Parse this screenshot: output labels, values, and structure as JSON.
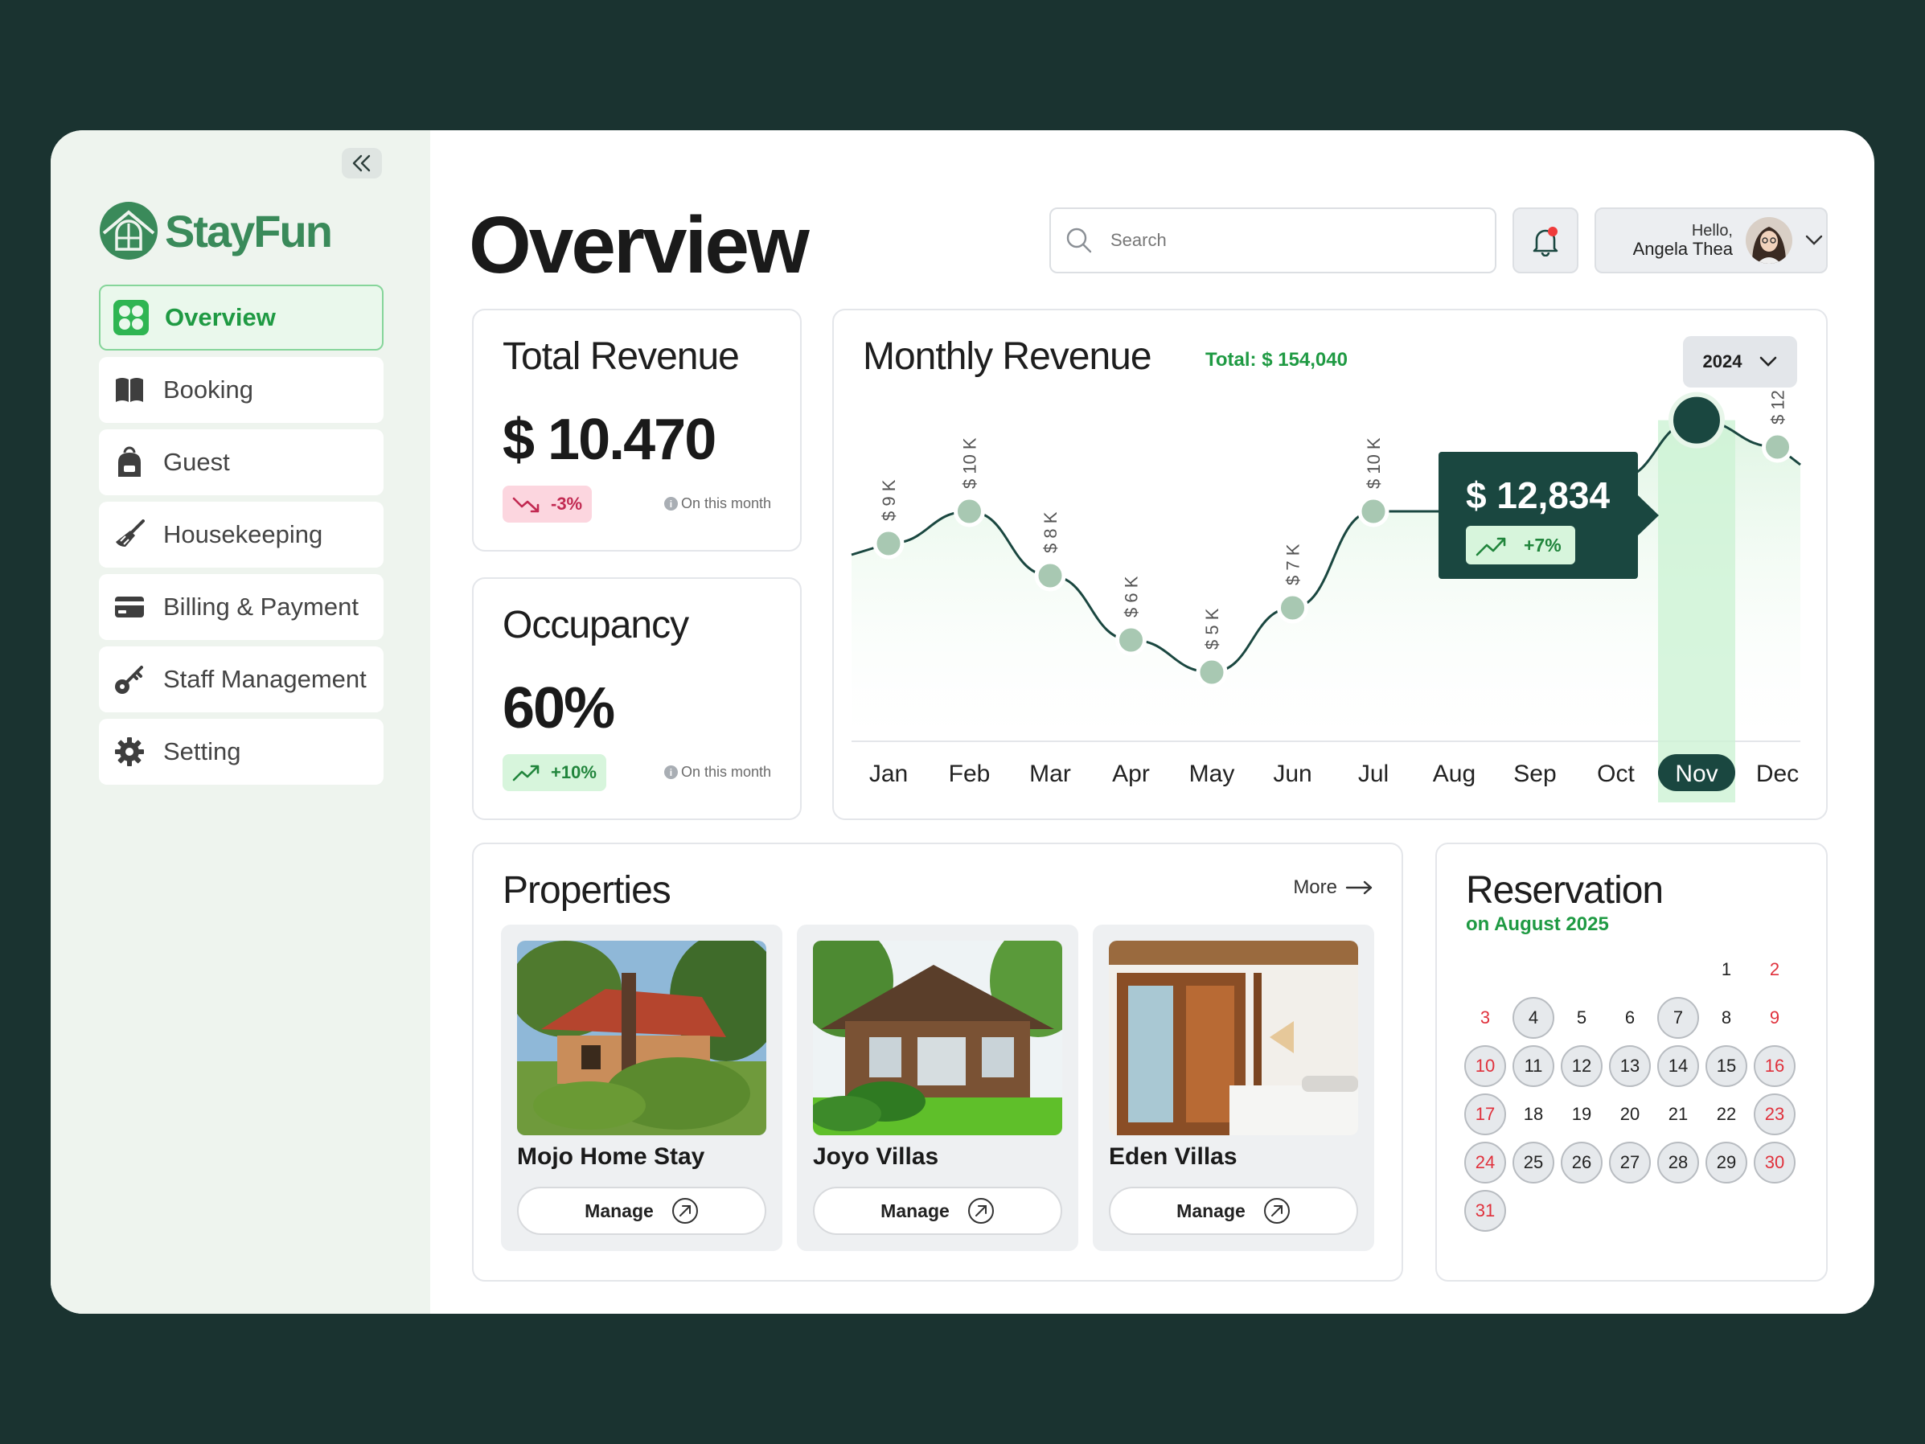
{
  "app": {
    "brand": "StayFun",
    "page_title": "Overview"
  },
  "sidebar": {
    "items": [
      {
        "label": "Overview",
        "icon": "grid-icon",
        "active": true
      },
      {
        "label": "Booking",
        "icon": "book-icon",
        "active": false
      },
      {
        "label": "Guest",
        "icon": "backpack-icon",
        "active": false
      },
      {
        "label": "Housekeeping",
        "icon": "broom-icon",
        "active": false
      },
      {
        "label": "Billing & Payment",
        "icon": "card-icon",
        "active": false
      },
      {
        "label": "Staff Management",
        "icon": "key-icon",
        "active": false
      },
      {
        "label": "Setting",
        "icon": "gear-icon",
        "active": false
      }
    ]
  },
  "header": {
    "search_placeholder": "Search",
    "hello": "Hello,",
    "user_name": "Angela Thea"
  },
  "total_revenue": {
    "title": "Total Revenue",
    "value": "$ 10.470",
    "change": "-3%",
    "note": "On this month"
  },
  "occupancy": {
    "title": "Occupancy",
    "value": "60%",
    "change": "+10%",
    "note": "On this month"
  },
  "monthly_revenue": {
    "title": "Monthly Revenue",
    "total": "Total: $ 154,040",
    "year": "2024",
    "tooltip_value": "$ 12,834",
    "tooltip_change": "+7%",
    "selected_month": "Nov"
  },
  "chart_data": {
    "type": "area",
    "categories": [
      "Jan",
      "Feb",
      "Mar",
      "Apr",
      "May",
      "Jun",
      "Jul",
      "Aug",
      "Sep",
      "Oct",
      "Nov",
      "Dec"
    ],
    "values": [
      9,
      10,
      8,
      6,
      5,
      7,
      10,
      10,
      9,
      11,
      12.834,
      12
    ],
    "labels": [
      "$ 9 K",
      "$ 10 K",
      "$ 8 K",
      "$ 6 K",
      "$ 5 K",
      "$ 7 K",
      "$ 10 K",
      "",
      "",
      "",
      "",
      "$ 12 K"
    ],
    "ylim": [
      0,
      16
    ],
    "accent": "#1a4740",
    "point_color": "#a8c8b2",
    "fill_color": "#dff5e3"
  },
  "properties": {
    "title": "Properties",
    "more_label": "More",
    "manage_label": "Manage",
    "items": [
      {
        "name": "Mojo Home Stay"
      },
      {
        "name": "Joyo Villas"
      },
      {
        "name": "Eden Villas"
      }
    ]
  },
  "reservation": {
    "title": "Reservation",
    "subtitle": "on August 2025",
    "start_offset": 5,
    "days_in_month": 31,
    "booked_days": [
      4,
      7,
      10,
      11,
      12,
      13,
      14,
      15,
      16,
      17,
      23,
      24,
      25,
      26,
      27,
      28,
      29,
      30,
      31
    ],
    "weekend_days": [
      2,
      3,
      9,
      10,
      16,
      17,
      23,
      24,
      30,
      31
    ]
  },
  "colors": {
    "brand_green": "#3a8a5a",
    "accent_green": "#1f9a43",
    "dark_teal": "#1a4740",
    "negative": "#c22a52"
  }
}
